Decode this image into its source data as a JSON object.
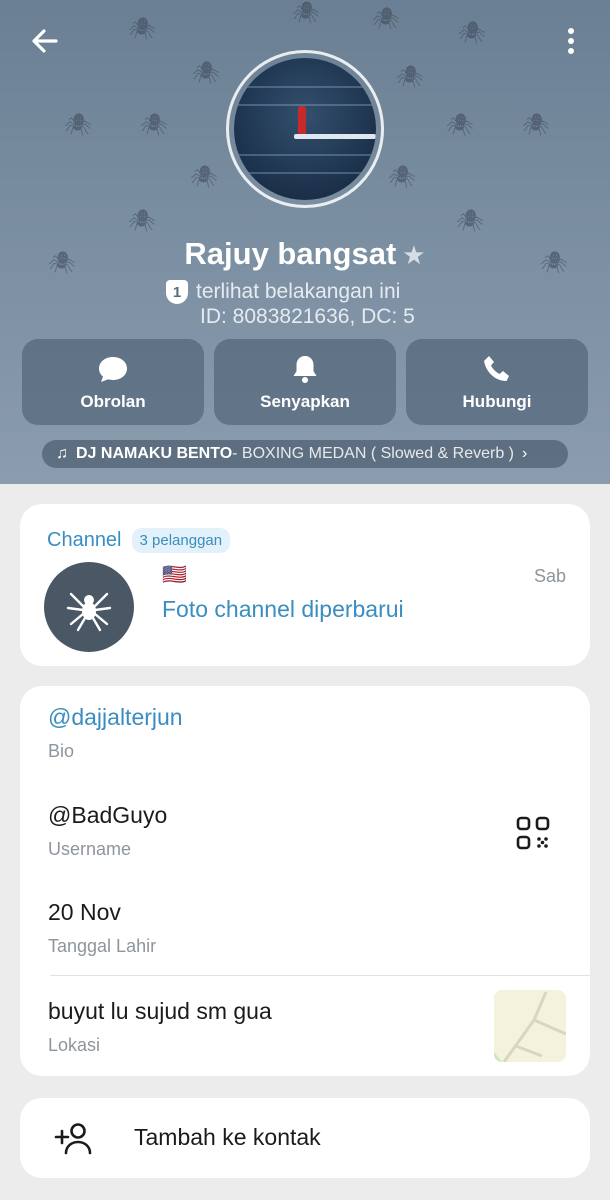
{
  "header": {
    "name": "Rajuy bangsat",
    "last_seen": "terlihat belakangan ini",
    "shield_number": "1",
    "id_line": "ID: 8083821636, DC: 5"
  },
  "actions": [
    {
      "label": "Obrolan",
      "icon": "chat-bubble-icon"
    },
    {
      "label": "Senyapkan",
      "icon": "bell-icon"
    },
    {
      "label": "Hubungi",
      "icon": "phone-icon"
    }
  ],
  "music": {
    "artist": "DJ NAMAKU BENTO",
    "title": " - BOXING MEDAN ( Slowed & Reverb )"
  },
  "channel": {
    "title": "Channel",
    "badge": "3 pelanggan",
    "flag": "🇺🇸",
    "time": "Sab",
    "message": "Foto channel diperbarui"
  },
  "info": {
    "bio_value": "@dajjalterjun",
    "bio_label": "Bio",
    "username_value": "@BadGuyo",
    "username_label": "Username",
    "birthday_value": "20 Nov",
    "birthday_label": "Tanggal Lahir",
    "location_value": "buyut lu sujud sm gua",
    "location_label": "Lokasi"
  },
  "add_contact": {
    "label": "Tambah ke kontak"
  },
  "colors": {
    "accent": "#3a8dc0",
    "header_bg": "#7a8ea1",
    "card_bg": "#ffffff",
    "page_bg": "#ececec"
  }
}
